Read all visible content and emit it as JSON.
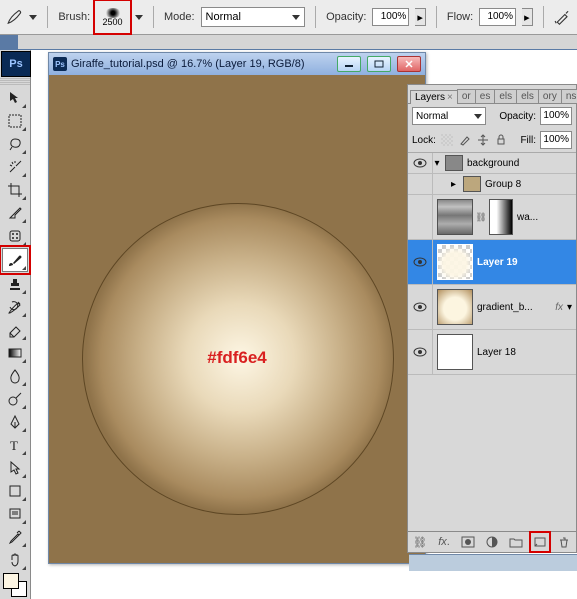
{
  "optbar": {
    "brush_label": "Brush:",
    "brush_size": "2500",
    "mode_label": "Mode:",
    "mode_value": "Normal",
    "opacity_label": "Opacity:",
    "opacity_value": "100%",
    "flow_label": "Flow:",
    "flow_value": "100%"
  },
  "document": {
    "title": "Giraffe_tutorial.psd @ 16.7% (Layer 19, RGB/8)",
    "annotation_hex": "#fdf6e4"
  },
  "layers_panel": {
    "tabs": [
      "Layers",
      "or",
      "es",
      "els",
      "els",
      "ory",
      "ns"
    ],
    "blend_label": "Normal",
    "opacity_label": "Opacity:",
    "opacity_value": "100%",
    "lock_label": "Lock:",
    "fill_label": "Fill:",
    "fill_value": "100%",
    "group_header": "background",
    "group8": "Group 8",
    "fx_label": "fx",
    "layers": [
      {
        "name": "wa..."
      },
      {
        "name": "Layer 19"
      },
      {
        "name": "gradient_b..."
      },
      {
        "name": "Layer 18"
      }
    ]
  }
}
